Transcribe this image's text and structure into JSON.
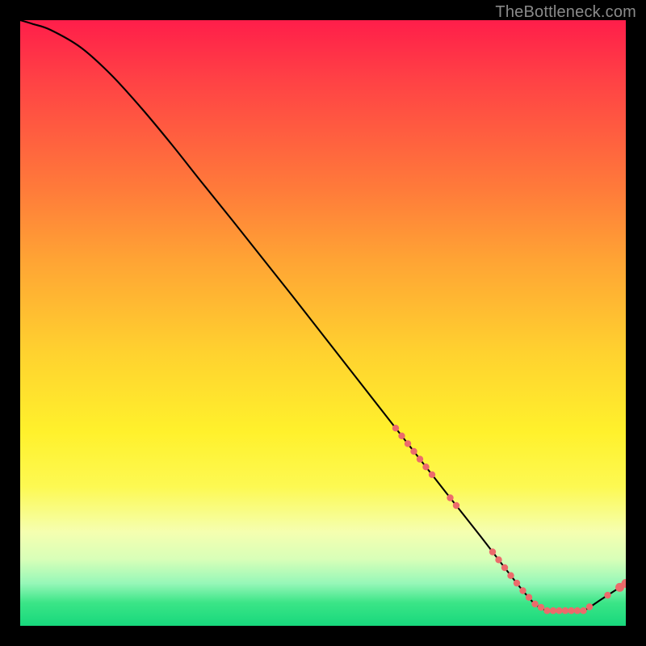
{
  "watermark": "TheBottleneck.com",
  "chart_data": {
    "type": "line",
    "title": "",
    "xlabel": "",
    "ylabel": "",
    "x": [
      0,
      2,
      5,
      10,
      15,
      20,
      25,
      30,
      35,
      40,
      45,
      50,
      55,
      60,
      65,
      70,
      73,
      76,
      79,
      81,
      83,
      85,
      87,
      89,
      91,
      93,
      96,
      100
    ],
    "values": [
      100,
      99.4,
      98.4,
      95.5,
      91,
      85.5,
      79.5,
      73.2,
      67,
      60.7,
      54.4,
      48,
      41.6,
      35.2,
      28.8,
      22.4,
      18.6,
      14.8,
      10.9,
      8.3,
      5.8,
      3.6,
      2.5,
      2.5,
      2.5,
      2.5,
      4.4,
      7.0
    ],
    "xlim": [
      0,
      100
    ],
    "ylim": [
      0,
      100
    ],
    "markers": {
      "x": [
        62,
        63,
        64,
        65,
        66,
        67,
        68,
        71,
        72,
        78,
        79,
        80,
        81,
        82,
        83,
        84,
        85,
        86,
        87,
        88,
        89,
        90,
        91,
        92,
        93,
        94,
        97,
        99,
        100
      ],
      "color": "#ec6b6b",
      "radius_small": 4.2,
      "radius_big": 5.5,
      "big_index_from": 27
    }
  }
}
